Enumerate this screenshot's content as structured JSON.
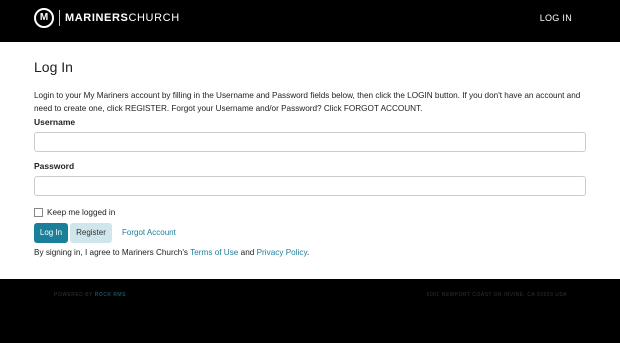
{
  "header": {
    "logo_mark": "M",
    "logo_bold": "MARINERS",
    "logo_light": "CHURCH",
    "login_link": "LOG IN"
  },
  "main": {
    "title": "Log In",
    "intro": "Login to your My Mariners account by filling in the Username and Password fields below, then click the LOGIN button. If you don't have an account and need to create one, click REGISTER. Forgot your Username and/or Password? Click FORGOT ACCOUNT.",
    "username_label": "Username",
    "username_value": "",
    "password_label": "Password",
    "password_value": "",
    "keep_logged_in_label": "Keep me logged in",
    "keep_logged_in_checked": false,
    "login_button": "Log In",
    "register_button": "Register",
    "forgot_button": "Forgot Account",
    "agree_prefix": "By signing in, I agree to Mariners Church's ",
    "terms_link": "Terms of Use",
    "agree_and": " and ",
    "privacy_link": "Privacy Policy",
    "agree_suffix": "."
  },
  "footer": {
    "powered_by": "POWERED BY",
    "rock_link": "ROCK RMS",
    "address": "5001 NEWPORT COAST DR IRVINE, CA 92603 USA"
  },
  "colors": {
    "accent": "#1b7f9a",
    "register_bg": "#cfe6ec",
    "header_bg": "#000000",
    "main_bg": "#ffffff"
  }
}
